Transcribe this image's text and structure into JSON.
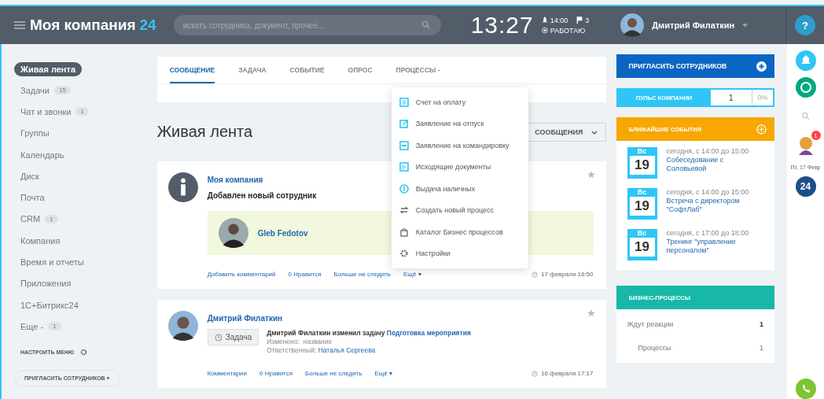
{
  "header": {
    "logo_name": "Моя компания",
    "logo_number": "24",
    "search": {
      "placeholder": "искать сотрудника, документ, прочее..."
    },
    "time": "13:27",
    "alarm": "14:00",
    "flags": "3",
    "status": "РАБОТАЮ",
    "user": "Дмитрий Филаткин",
    "help": "?"
  },
  "sidebar": {
    "items": [
      {
        "label": "Живая лента",
        "selected": true
      },
      {
        "label": "Задачи",
        "counter": "15",
        "selected": false
      },
      {
        "label": "Чат и звонки",
        "counter": "1",
        "selected": false
      },
      {
        "label": "Группы",
        "selected": false
      },
      {
        "label": "Календарь",
        "selected": false
      },
      {
        "label": "Диск",
        "selected": false
      },
      {
        "label": "Почта",
        "selected": false
      },
      {
        "label": "CRM",
        "counter": "1",
        "selected": false
      },
      {
        "label": "Компания",
        "selected": false
      },
      {
        "label": "Время и отчеты",
        "selected": false
      },
      {
        "label": "Приложения",
        "selected": false
      },
      {
        "label": "1С+Битрикс24",
        "selected": false
      },
      {
        "label": "Еще -",
        "counter": "1",
        "selected": false
      }
    ],
    "configure": "НАСТРОИТЬ МЕНЮ",
    "invite": "ПРИГЛАСИТЬ СОТРУДНИКОВ +"
  },
  "composer": {
    "tabs": [
      {
        "label": "СООБЩЕНИЕ",
        "selected": true
      },
      {
        "label": "ЗАДАЧА",
        "selected": false
      },
      {
        "label": "СОБЫТИЕ",
        "selected": false
      },
      {
        "label": "ОПРОС",
        "selected": false
      },
      {
        "label": "ПРОЦЕССЫ -",
        "selected": false
      }
    ],
    "menu": [
      {
        "label": "Счет на оплату",
        "kind": "invoice"
      },
      {
        "label": "Заявление на отпуск",
        "kind": "vacation"
      },
      {
        "label": "Заявление на командировку",
        "kind": "trip"
      },
      {
        "label": "Исходящие документы",
        "kind": "docs"
      },
      {
        "label": "Выдача наличных",
        "kind": "cash"
      },
      {
        "label": "Создать новый процесс",
        "kind": "new"
      },
      {
        "label": "Каталог Бизнес процессов",
        "kind": "catalog"
      },
      {
        "label": "Настройки",
        "kind": "settings"
      }
    ]
  },
  "feed": {
    "title": "Живая лента",
    "filter": "СООБЩЕНИЯ",
    "posts": [
      {
        "kind": "info",
        "author": "Моя компания",
        "headline": "Добавлен новый сотрудник",
        "employee": "Gleb Fedotov",
        "actions": [
          "Добавить комментарий",
          "0 Нравится",
          "Больше не следить",
          "Ещё ▾"
        ],
        "date": "17 февраля 16:50"
      },
      {
        "kind": "task",
        "author": "Дмитрий Филаткин",
        "badge": "Задача",
        "line": "Дмитрий Филаткин изменил задачу",
        "task": "Подготовка мероприятия",
        "changed_label": "Изменено:",
        "changed": "название",
        "resp_label": "Ответственный:",
        "resp": "Наталья Сергеева",
        "actions": [
          "Комментарии",
          "0 Нравится",
          "Больше не следить",
          "Ещё ▾"
        ],
        "date": "16 февраля 17:17"
      }
    ]
  },
  "right": {
    "invite": "ПРИГЛАСИТЬ СОТРУДНИКОВ",
    "pulse": {
      "label": "ПУЛЬС КОМПАНИИ",
      "count": "1",
      "percent": "0%"
    },
    "events_title": "БЛИЖАЙШИЕ СОБЫТИЯ",
    "events": [
      {
        "day": "Вс",
        "date": "19",
        "time": "сегодня, с 14:00 до 15:00",
        "title": "Собеседование с Соловьевой"
      },
      {
        "day": "Вс",
        "date": "19",
        "time": "сегодня, с 14:00 до 15:00",
        "title": "Встреча с директором \"СофтЛаб\""
      },
      {
        "day": "Вс",
        "date": "19",
        "time": "сегодня, с 17:00 до 18:00",
        "title": "Тренинг \"управление персоналом\""
      }
    ],
    "bp_title": "БИЗНЕС-ПРОЦЕССЫ",
    "bp_rows": [
      {
        "label": "Ждут реакции",
        "value": "1",
        "kind": "main"
      },
      {
        "label": "Процессы",
        "value": "1",
        "kind": "sub"
      }
    ]
  },
  "dock": {
    "badge": "1",
    "date": "Пт, 17 Февр",
    "logo": "24"
  }
}
